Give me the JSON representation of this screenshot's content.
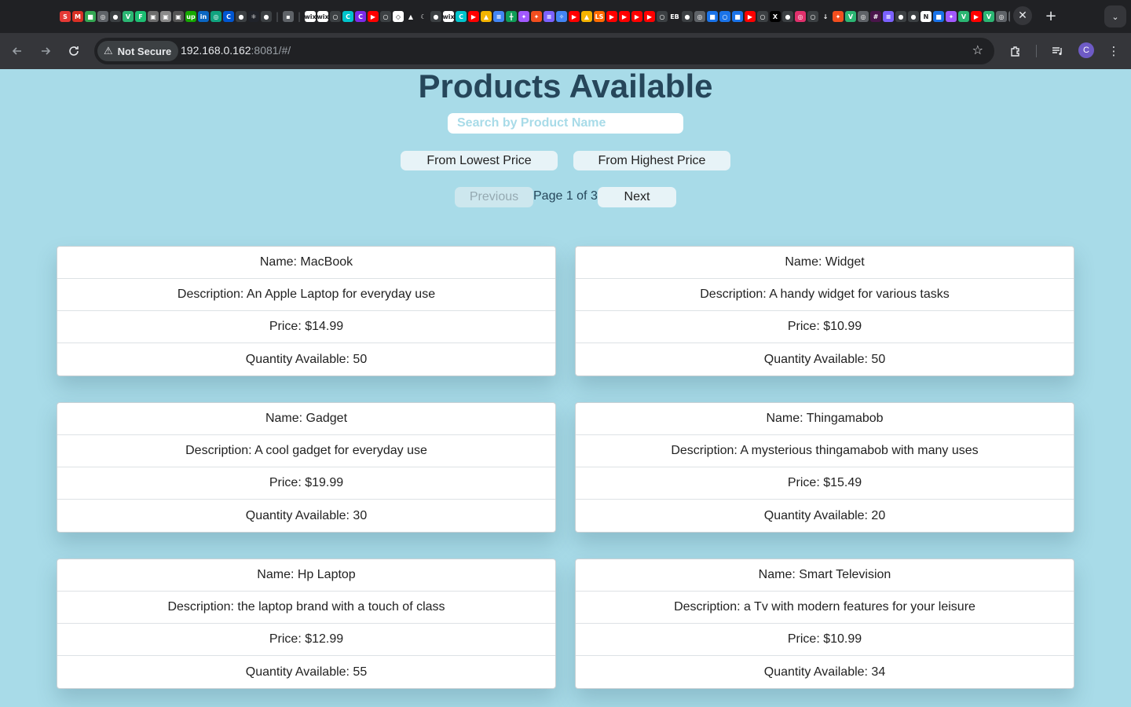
{
  "browser": {
    "favicons": [
      {
        "name": "s-icon",
        "glyph": "S",
        "bg": "#e53935"
      },
      {
        "name": "gmail-icon",
        "glyph": "M",
        "bg": "#d93025"
      },
      {
        "name": "bookmark-icon",
        "glyph": "■",
        "bg": "#34a853"
      },
      {
        "name": "openai-icon",
        "glyph": "◎",
        "bg": "#5f6368"
      },
      {
        "name": "github-icon",
        "glyph": "●",
        "bg": "#3c4043"
      },
      {
        "name": "v-icon",
        "glyph": "V",
        "bg": "#2bb673"
      },
      {
        "name": "fiverr-icon",
        "glyph": "F",
        "bg": "#1dbf73"
      },
      {
        "name": "image-icon",
        "glyph": "▣",
        "bg": "#6d6d6d"
      },
      {
        "name": "image-icon",
        "glyph": "▣",
        "bg": "#8a8a8a"
      },
      {
        "name": "image-icon",
        "glyph": "▣",
        "bg": "#555"
      },
      {
        "name": "upwork-icon",
        "glyph": "up",
        "bg": "#14a800"
      },
      {
        "name": "linkedin-icon",
        "glyph": "in",
        "bg": "#0a66c2"
      },
      {
        "name": "chatgpt-icon",
        "glyph": "◎",
        "bg": "#10a37f"
      },
      {
        "name": "coursera-icon",
        "glyph": "C",
        "bg": "#0056d2"
      },
      {
        "name": "github-icon",
        "glyph": "●",
        "bg": "#3c4043"
      },
      {
        "name": "react-icon",
        "glyph": "⚛",
        "bg": "#20232a"
      },
      {
        "name": "github-icon",
        "glyph": "●",
        "bg": "#3c4043"
      },
      {
        "name": "separator",
        "glyph": "|",
        "bg": ""
      },
      {
        "name": "folder-icon",
        "glyph": "▪",
        "bg": "#5f6368"
      },
      {
        "name": "separator",
        "glyph": "|",
        "bg": ""
      },
      {
        "name": "wix-icon",
        "glyph": "wix",
        "bg": "#ffffff"
      },
      {
        "name": "wix-icon",
        "glyph": "wix",
        "bg": "#ffffff"
      },
      {
        "name": "search-icon",
        "glyph": "○",
        "bg": "#3c4043"
      },
      {
        "name": "canva-icon",
        "glyph": "C",
        "bg": "#00c4cc"
      },
      {
        "name": "canva-icon",
        "glyph": "C",
        "bg": "#7d2ae8"
      },
      {
        "name": "youtube-icon",
        "glyph": "▶",
        "bg": "#ff0000"
      },
      {
        "name": "search-icon",
        "glyph": "○",
        "bg": "#3c4043"
      },
      {
        "name": "codepen-icon",
        "glyph": "◇",
        "bg": "#ffffff"
      },
      {
        "name": "triangle-icon",
        "glyph": "▲",
        "bg": "#202124"
      },
      {
        "name": "moon-icon",
        "glyph": "☾",
        "bg": "#202124"
      },
      {
        "name": "github-icon",
        "glyph": "●",
        "bg": "#3c4043"
      },
      {
        "name": "wix-icon",
        "glyph": "wix",
        "bg": "#ffffff"
      },
      {
        "name": "canva-icon",
        "glyph": "C",
        "bg": "#00c4cc"
      },
      {
        "name": "youtube-icon",
        "glyph": "▶",
        "bg": "#ff0000"
      },
      {
        "name": "drive-icon",
        "glyph": "▲",
        "bg": "#f4b400"
      },
      {
        "name": "docs-icon",
        "glyph": "≡",
        "bg": "#4285f4"
      },
      {
        "name": "sheets-icon",
        "glyph": "╋",
        "bg": "#0f9d58"
      },
      {
        "name": "figma-icon",
        "glyph": "✦",
        "bg": "#a259ff"
      },
      {
        "name": "figma-icon",
        "glyph": "✦",
        "bg": "#f24e1e"
      },
      {
        "name": "list-icon",
        "glyph": "≡",
        "bg": "#7b61ff"
      },
      {
        "name": "sparkle-icon",
        "glyph": "✧",
        "bg": "#4285f4"
      },
      {
        "name": "youtube-icon",
        "glyph": "▶",
        "bg": "#ff0000"
      },
      {
        "name": "drive-icon",
        "glyph": "▲",
        "bg": "#f4b400"
      },
      {
        "name": "ls-icon",
        "glyph": "LS",
        "bg": "#ff6b00"
      },
      {
        "name": "youtube-icon",
        "glyph": "▶",
        "bg": "#ff0000"
      },
      {
        "name": "youtube-icon",
        "glyph": "▶",
        "bg": "#ff0000"
      },
      {
        "name": "youtube-icon",
        "glyph": "▶",
        "bg": "#ff0000"
      },
      {
        "name": "youtube-icon",
        "glyph": "▶",
        "bg": "#ff0000"
      },
      {
        "name": "search-icon",
        "glyph": "○",
        "bg": "#3c4043"
      },
      {
        "name": "eb-icon",
        "glyph": "EB",
        "bg": "#202124"
      },
      {
        "name": "github-icon",
        "glyph": "●",
        "bg": "#3c4043"
      },
      {
        "name": "openai-icon",
        "glyph": "◎",
        "bg": "#5f6368"
      },
      {
        "name": "bookmark-icon",
        "glyph": "■",
        "bg": "#1a73e8"
      },
      {
        "name": "search-icon",
        "glyph": "○",
        "bg": "#1a73e8"
      },
      {
        "name": "bookmark-icon",
        "glyph": "■",
        "bg": "#1a73e8"
      },
      {
        "name": "youtube-icon",
        "glyph": "▶",
        "bg": "#ff0000"
      },
      {
        "name": "search-icon",
        "glyph": "○",
        "bg": "#3c4043"
      },
      {
        "name": "x-icon",
        "glyph": "X",
        "bg": "#000000"
      },
      {
        "name": "github-icon",
        "glyph": "●",
        "bg": "#3c4043"
      },
      {
        "name": "instagram-icon",
        "glyph": "◎",
        "bg": "#e1306c"
      },
      {
        "name": "search-icon",
        "glyph": "○",
        "bg": "#3c4043"
      },
      {
        "name": "download-icon",
        "glyph": "↓",
        "bg": "#202124"
      },
      {
        "name": "figma-icon",
        "glyph": "✦",
        "bg": "#f24e1e"
      },
      {
        "name": "v-icon",
        "glyph": "V",
        "bg": "#2bb673"
      },
      {
        "name": "openai-icon",
        "glyph": "◎",
        "bg": "#5f6368"
      },
      {
        "name": "slack-icon",
        "glyph": "#",
        "bg": "#4a154b"
      },
      {
        "name": "list-icon",
        "glyph": "≡",
        "bg": "#7b61ff"
      },
      {
        "name": "github-icon",
        "glyph": "●",
        "bg": "#3c4043"
      },
      {
        "name": "github-icon",
        "glyph": "●",
        "bg": "#3c4043"
      },
      {
        "name": "notion-icon",
        "glyph": "N",
        "bg": "#ffffff"
      },
      {
        "name": "bookmark-icon",
        "glyph": "■",
        "bg": "#1a73e8"
      },
      {
        "name": "figma-icon",
        "glyph": "✦",
        "bg": "#a259ff"
      },
      {
        "name": "v-icon",
        "glyph": "V",
        "bg": "#2bb673"
      },
      {
        "name": "youtube-icon",
        "glyph": "▶",
        "bg": "#ff0000"
      },
      {
        "name": "v-icon",
        "glyph": "V",
        "bg": "#2bb673"
      },
      {
        "name": "openai-icon",
        "glyph": "◎",
        "bg": "#5f6368"
      },
      {
        "name": "openai-icon",
        "glyph": "◎",
        "bg": "#5f6368"
      },
      {
        "name": "v-icon",
        "glyph": "V",
        "bg": "#2bb673"
      }
    ],
    "tab_close_glyph": "✕",
    "new_tab_glyph": "+",
    "tab_search_glyph": "⌄",
    "security_label": "Not Secure",
    "url_host": "192.168.0.162",
    "url_rest": ":8081/#/",
    "avatar_initial": "C",
    "colors": {
      "chrome_dark": "#202124",
      "chrome_toolbar": "#35363a",
      "page_bg": "#a8dbe8"
    }
  },
  "page": {
    "title": "Products Available",
    "search_placeholder": "Search by Product Name",
    "sort_low_label": "From Lowest Price",
    "sort_high_label": "From Highest Price",
    "prev_label": "Previous",
    "next_label": "Next",
    "page_indicator": "Page 1 of 3"
  },
  "products": [
    {
      "name": "Name: MacBook",
      "description": "Description: An Apple Laptop for everyday use",
      "price": "Price: $14.99",
      "quantity": "Quantity Available: 50"
    },
    {
      "name": "Name: Widget",
      "description": "Description: A handy widget for various tasks",
      "price": "Price: $10.99",
      "quantity": "Quantity Available: 50"
    },
    {
      "name": "Name: Gadget",
      "description": "Description: A cool gadget for everyday use",
      "price": "Price: $19.99",
      "quantity": "Quantity Available: 30"
    },
    {
      "name": "Name: Thingamabob",
      "description": "Description: A mysterious thingamabob with many uses",
      "price": "Price: $15.49",
      "quantity": "Quantity Available: 20"
    },
    {
      "name": "Name: Hp Laptop",
      "description": "Description: the laptop brand with a touch of class",
      "price": "Price: $12.99",
      "quantity": "Quantity Available: 55"
    },
    {
      "name": "Name: Smart Television",
      "description": "Description: a Tv with modern features for your leisure",
      "price": "Price: $10.99",
      "quantity": "Quantity Available: 34"
    }
  ]
}
